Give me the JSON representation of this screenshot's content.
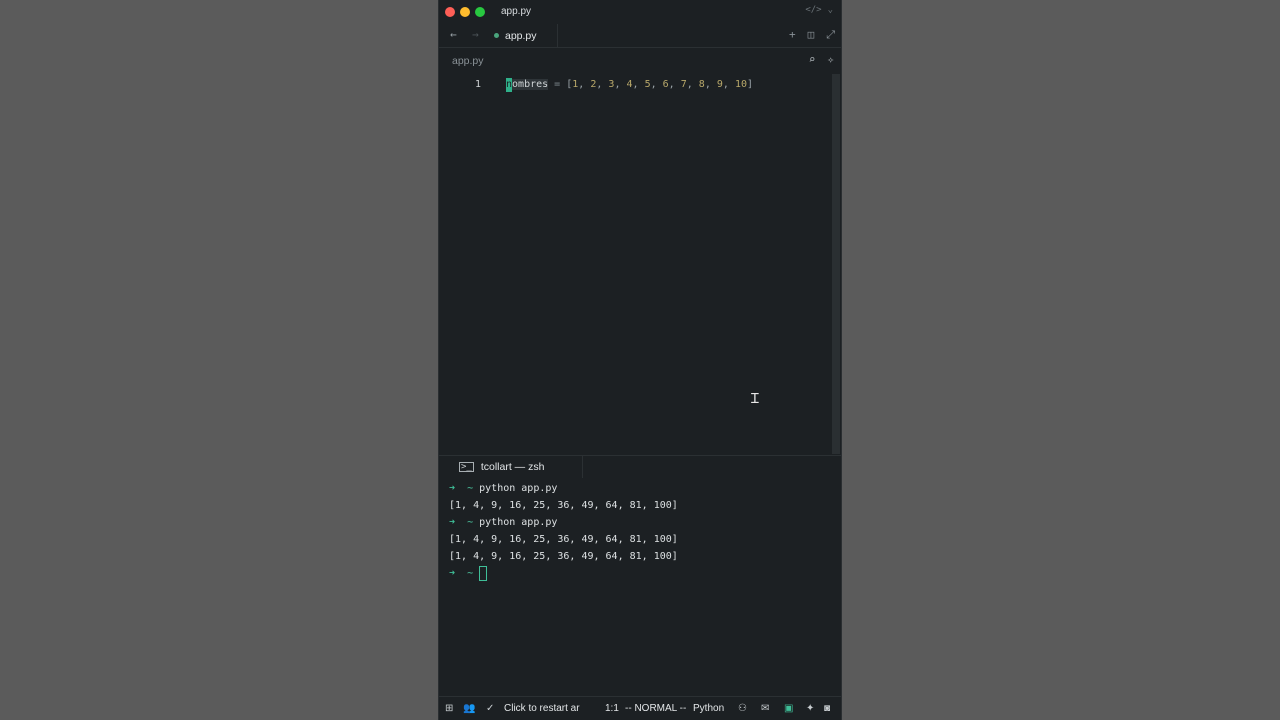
{
  "window": {
    "title": "app.py"
  },
  "tab": {
    "label": "app.py"
  },
  "breadcrumb": "app.py",
  "editor": {
    "line_number": "1",
    "cursor_char": "n",
    "ident_rest": "ombres",
    "op": " = ",
    "open": "[",
    "numbers": [
      "1",
      "2",
      "3",
      "4",
      "5",
      "6",
      "7",
      "8",
      "9",
      "10"
    ],
    "close": "]"
  },
  "terminal": {
    "tab_label": "tcollart — zsh",
    "prompt_symbol": "➜",
    "prompt_dir": "~",
    "cmd1": "python app.py",
    "out1": "[1, 4, 9, 16, 25, 36, 49, 64, 81, 100]",
    "cmd2": "python app.py",
    "out2": "[1, 4, 9, 16, 25, 36, 49, 64, 81, 100]",
    "out3": "[1, 4, 9, 16, 25, 36, 49, 64, 81, 100]"
  },
  "status": {
    "message": "Click to restart ar",
    "position": "1:1",
    "mode": "-- NORMAL --",
    "language": "Python"
  },
  "colors": {
    "accent": "#3fbf98",
    "background": "#1c2023"
  }
}
